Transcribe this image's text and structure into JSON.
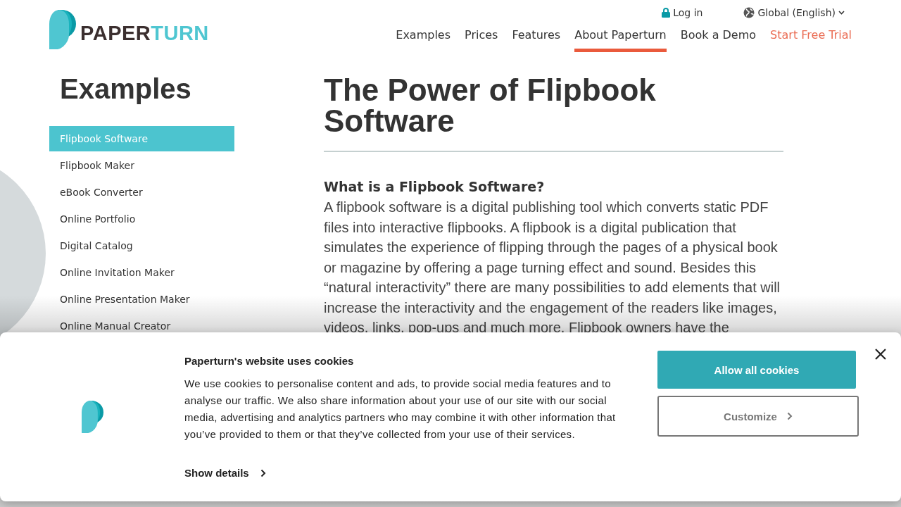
{
  "header": {
    "logo": {
      "part_1": "PAPER",
      "part_2": "TURN"
    },
    "login": "Log in",
    "language": "Global (English)",
    "nav": [
      {
        "label": "Examples",
        "selected": false,
        "kind": "link"
      },
      {
        "label": "Prices",
        "selected": false,
        "kind": "link"
      },
      {
        "label": "Features",
        "selected": false,
        "kind": "link"
      },
      {
        "label": "About Paperturn",
        "selected": true,
        "kind": "link"
      },
      {
        "label": "Book a Demo",
        "selected": false,
        "kind": "link"
      },
      {
        "label": "Start Free Trial",
        "selected": false,
        "kind": "cta"
      }
    ]
  },
  "sidebar": {
    "title": "Examples",
    "items": [
      {
        "label": "Flipbook Software",
        "selected": true
      },
      {
        "label": "Flipbook Maker",
        "selected": false
      },
      {
        "label": "eBook Converter",
        "selected": false
      },
      {
        "label": "Online Portfolio",
        "selected": false
      },
      {
        "label": "Digital Catalog",
        "selected": false
      },
      {
        "label": "Online Invitation Maker",
        "selected": false
      },
      {
        "label": "Online Presentation Maker",
        "selected": false
      },
      {
        "label": "Online Manual Creator",
        "selected": false
      }
    ]
  },
  "article": {
    "title": "The Power of Flipbook Software",
    "subtitle": "What is a Flipbook Software?",
    "paragraph": "A flipbook software is a digital publishing tool which converts static PDF files into interactive flipbooks. A flipbook is a digital publication that simulates the experience of flipping through the pages of a physical book or magazine by offering a page turning effect and sound. Besides this “natural interactivity” there are many possibilities to add elements that will increase the interactivity and the engagement of the readers like images, videos, links, pop-ups and much more. Flipbook owners have the"
  },
  "cookie_banner": {
    "title": "Paperturn's website uses cookies",
    "text": "We use cookies to personalise content and ads, to provide social media features and to analyse our traffic. We also share information about your use of our site with our social media, advertising and analytics partners who may combine it with other information that you’ve provided to them or that they’ve collected from your use of their services.",
    "show_details": "Show details",
    "allow_button": "Allow all cookies",
    "customize_button": "Customize"
  }
}
